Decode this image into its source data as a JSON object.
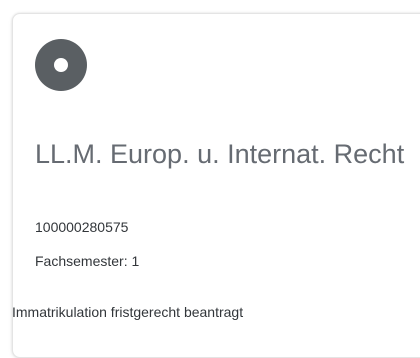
{
  "card": {
    "icon": "disc-icon",
    "title": "LL.M. Europ. u. Internat. Recht",
    "number": "100000280575",
    "semester": "Fachsemester: 1",
    "status": "Immatrikulation fristgerecht beantragt"
  },
  "colors": {
    "icon": "#5a5f63",
    "title": "#666b72",
    "text": "#32363a",
    "border": "#e4e4e4"
  }
}
